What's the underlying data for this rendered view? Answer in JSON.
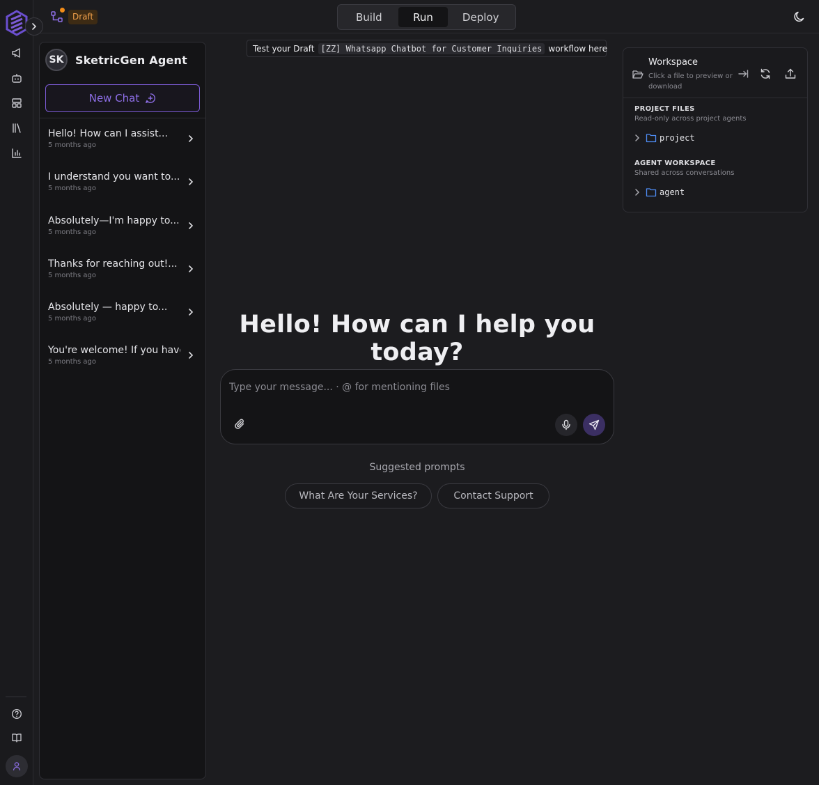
{
  "topbar": {
    "draft_badge": "Draft",
    "tabs": [
      {
        "label": "Build",
        "active": false
      },
      {
        "label": "Run",
        "active": true
      },
      {
        "label": "Deploy",
        "active": false
      }
    ]
  },
  "agent": {
    "initials": "SK",
    "name": "SketricGen Agent",
    "new_chat_label": "New Chat"
  },
  "chats": [
    {
      "title": "Hello! How can I assist...",
      "time": "5 months ago"
    },
    {
      "title": "I understand you want to...",
      "time": "5 months ago"
    },
    {
      "title": "Absolutely—I'm happy to...",
      "time": "5 months ago"
    },
    {
      "title": "Thanks for reaching out!...",
      "time": "5 months ago"
    },
    {
      "title": "Absolutely — happy to...",
      "time": "5 months ago"
    },
    {
      "title": "You're welcome! If you have...",
      "time": "5 months ago"
    }
  ],
  "banner": {
    "prefix": "Test your Draft",
    "workflow": "[ZZ] Whatsapp Chatbot for Customer Inquiries",
    "suffix": "workflow here"
  },
  "main": {
    "hero": "Hello! How can I help you today?",
    "composer_placeholder": "Type your message... · @ for mentioning files",
    "suggested_label": "Suggested prompts",
    "prompts": [
      "What Are Your Services?",
      "Contact Support"
    ]
  },
  "workspace": {
    "title": "Workspace",
    "subtitle": "Click a file to preview or download",
    "project_title": "PROJECT FILES",
    "project_sub": "Read-only across project agents",
    "project_folder": "project",
    "agent_title": "AGENT WORKSPACE",
    "agent_sub": "Shared across conversations",
    "agent_folder": "agent"
  },
  "colors": {
    "accent": "#7c5bd6",
    "draft": "#f0a04b",
    "folder": "#4f8df5"
  }
}
